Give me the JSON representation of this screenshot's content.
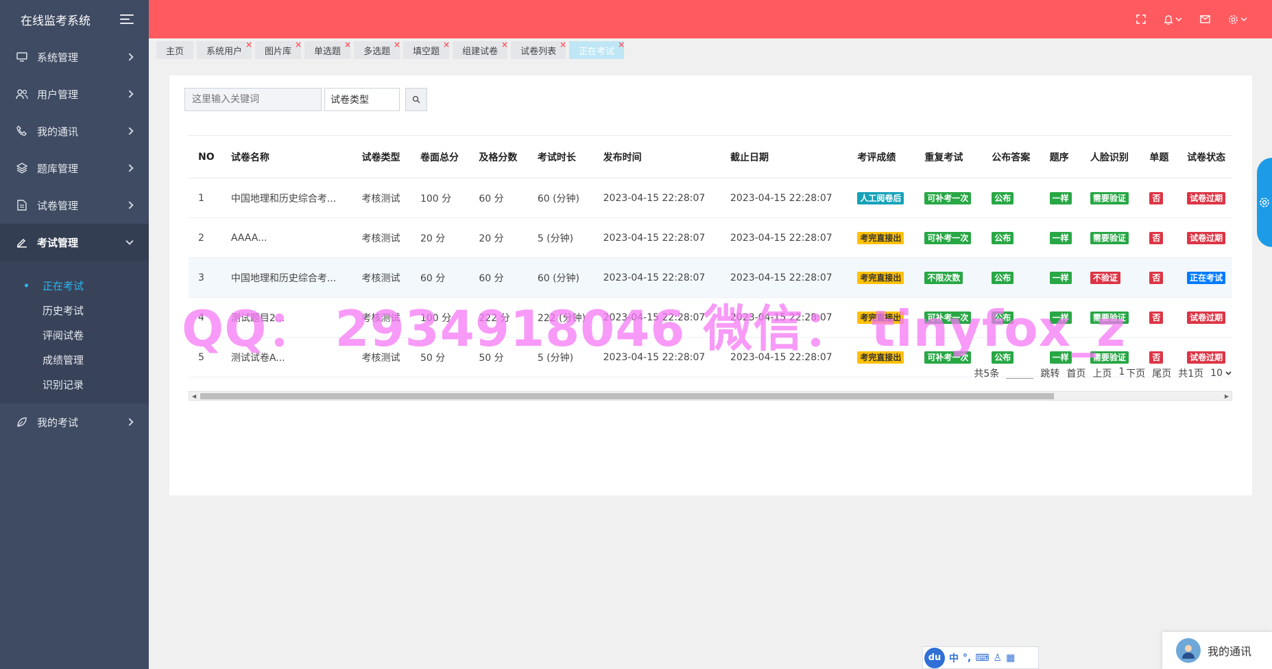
{
  "app": {
    "title": "在线监考系统"
  },
  "sidebar": {
    "menu": [
      {
        "label": "系统管理"
      },
      {
        "label": "用户管理"
      },
      {
        "label": "我的通讯"
      },
      {
        "label": "题库管理"
      },
      {
        "label": "试卷管理"
      },
      {
        "label": "考试管理"
      }
    ],
    "submenu": [
      "正在考试",
      "历史考试",
      "评阅试卷",
      "成绩管理",
      "识别记录"
    ],
    "last": {
      "label": "我的考试"
    }
  },
  "tabs": [
    "主页",
    "系统用户",
    "图片库",
    "单选题",
    "多选题",
    "填空题",
    "组建试卷",
    "试卷列表",
    "正在考试"
  ],
  "search": {
    "placeholder": "这里输入关键词",
    "type_label": "试卷类型"
  },
  "table": {
    "headers": [
      "NO",
      "试卷名称",
      "试卷类型",
      "卷面总分",
      "及格分数",
      "考试时长",
      "发布时间",
      "截止日期",
      "考评成绩",
      "重复考试",
      "公布答案",
      "题序",
      "人脸识别",
      "单题",
      "试卷状态"
    ],
    "rows": [
      {
        "no": "1",
        "name": "中国地理和历史综合考...",
        "type": "考核测试",
        "total": "100 分",
        "pass": "60 分",
        "duration": "60 (分钟)",
        "publish": "2023-04-15 22:28:07",
        "deadline": "2023-04-15 22:28:07",
        "grade": "人工阅卷后",
        "repeat": "可补考一次",
        "answer": "公布",
        "order": "一样",
        "face": "需要验证",
        "single": "否",
        "status": "试卷过期"
      },
      {
        "no": "2",
        "name": "AAAA...",
        "type": "考核测试",
        "total": "20 分",
        "pass": "20 分",
        "duration": "5 (分钟)",
        "publish": "2023-04-15 22:28:07",
        "deadline": "2023-04-15 22:28:07",
        "grade": "考完直接出",
        "repeat": "可补考一次",
        "answer": "公布",
        "order": "一样",
        "face": "需要验证",
        "single": "否",
        "status": "试卷过期"
      },
      {
        "no": "3",
        "name": "中国地理和历史综合考...",
        "type": "考核测试",
        "total": "60 分",
        "pass": "60 分",
        "duration": "60 (分钟)",
        "publish": "2023-04-15 22:28:07",
        "deadline": "2023-04-15 22:28:07",
        "grade": "考完直接出",
        "repeat": "不限次数",
        "answer": "公布",
        "order": "一样",
        "face": "不验证",
        "single": "否",
        "status": "正在考试"
      },
      {
        "no": "4",
        "name": "测试题目2...",
        "type": "考核测试",
        "total": "100 分",
        "pass": "222 分",
        "duration": "222 (分钟)",
        "publish": "2023-04-15 22:28:07",
        "deadline": "2023-04-15 22:28:07",
        "grade": "考完直接出",
        "repeat": "可补考一次",
        "answer": "公布",
        "order": "一样",
        "face": "需要验证",
        "single": "否",
        "status": "试卷过期"
      },
      {
        "no": "5",
        "name": "测试试卷A...",
        "type": "考核测试",
        "total": "50 分",
        "pass": "50 分",
        "duration": "5 (分钟)",
        "publish": "2023-04-15 22:28:07",
        "deadline": "2023-04-15 22:28:07",
        "grade": "考完直接出",
        "repeat": "可补考一次",
        "answer": "公布",
        "order": "一样",
        "face": "需要验证",
        "single": "否",
        "status": "试卷过期"
      }
    ]
  },
  "pager": {
    "total": "共5条",
    "jump": "跳转",
    "first": "首页",
    "prev": "上页",
    "current": "1",
    "next": "下页",
    "last": "尾页",
    "pages": "共1页",
    "size": "10"
  },
  "watermark": "QQ： 2934918046 微信： tinyfox_z",
  "chat": {
    "label": "我的通讯"
  },
  "ime": {
    "logo": "du",
    "mode": "中"
  },
  "colors": {
    "header": "#ff5a5f",
    "sidebar": "#3f4b62",
    "active": "#2ab7f0",
    "badge_blue": "#17a2b8",
    "badge_yellow": "#ffc107",
    "badge_green": "#28a745",
    "badge_red": "#dc3545",
    "badge_navy": "#007bff"
  }
}
